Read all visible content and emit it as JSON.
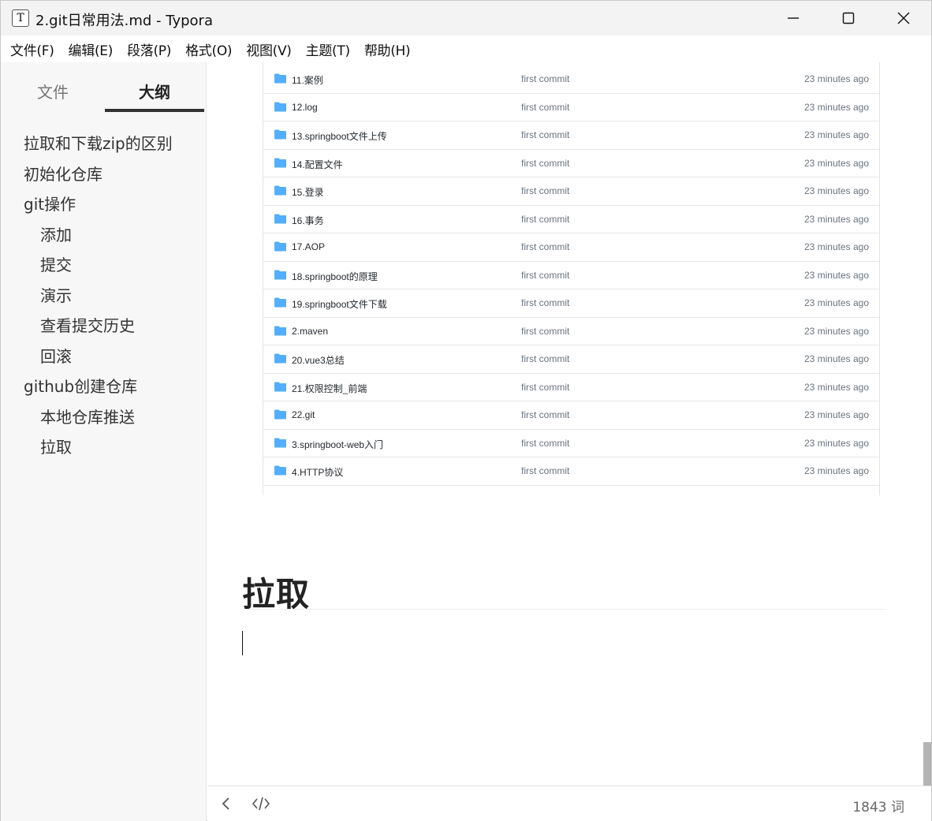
{
  "window": {
    "title": "2.git日常用法.md - Typora",
    "app_icon_letter": "T"
  },
  "menu": [
    "文件(F)",
    "编辑(E)",
    "段落(P)",
    "格式(O)",
    "视图(V)",
    "主题(T)",
    "帮助(H)"
  ],
  "sidebar": {
    "tabs": [
      "文件",
      "大纲"
    ],
    "active_tab": "大纲",
    "outline": [
      {
        "label": "拉取和下载zip的区别",
        "level": 2
      },
      {
        "label": "初始化仓库",
        "level": 2
      },
      {
        "label": "git操作",
        "level": 2
      },
      {
        "label": "添加",
        "level": 3
      },
      {
        "label": "提交",
        "level": 3
      },
      {
        "label": "演示",
        "level": 3
      },
      {
        "label": "查看提交历史",
        "level": 3
      },
      {
        "label": "回滚",
        "level": 3
      },
      {
        "label": "github创建仓库",
        "level": 2
      },
      {
        "label": "本地仓库推送",
        "level": 3
      },
      {
        "label": "拉取",
        "level": 3
      }
    ]
  },
  "repo_listing": [
    {
      "name": "11.案例",
      "message": "first commit",
      "time": "23 minutes ago"
    },
    {
      "name": "12.log",
      "message": "first commit",
      "time": "23 minutes ago"
    },
    {
      "name": "13.springboot文件上传",
      "message": "first commit",
      "time": "23 minutes ago"
    },
    {
      "name": "14.配置文件",
      "message": "first commit",
      "time": "23 minutes ago"
    },
    {
      "name": "15.登录",
      "message": "first commit",
      "time": "23 minutes ago"
    },
    {
      "name": "16.事务",
      "message": "first commit",
      "time": "23 minutes ago"
    },
    {
      "name": "17.AOP",
      "message": "first commit",
      "time": "23 minutes ago"
    },
    {
      "name": "18.springboot的原理",
      "message": "first commit",
      "time": "23 minutes ago"
    },
    {
      "name": "19.springboot文件下载",
      "message": "first commit",
      "time": "23 minutes ago"
    },
    {
      "name": "2.maven",
      "message": "first commit",
      "time": "23 minutes ago"
    },
    {
      "name": "20.vue3总结",
      "message": "first commit",
      "time": "23 minutes ago"
    },
    {
      "name": "21.权限控制_前端",
      "message": "first commit",
      "time": "23 minutes ago"
    },
    {
      "name": "22.git",
      "message": "first commit",
      "time": "23 minutes ago"
    },
    {
      "name": "3.springboot-web入门",
      "message": "first commit",
      "time": "23 minutes ago"
    },
    {
      "name": "4.HTTP协议",
      "message": "first commit",
      "time": "23 minutes ago"
    }
  ],
  "editor": {
    "heading": "拉取"
  },
  "status": {
    "word_count": "1843 词"
  },
  "colors": {
    "folder": "#54aeff",
    "accent": "#333333"
  },
  "icons": {
    "back": "chevron-left-icon",
    "source": "code-icon",
    "minimize": "minimize-icon",
    "maximize": "maximize-icon",
    "close": "close-icon"
  }
}
